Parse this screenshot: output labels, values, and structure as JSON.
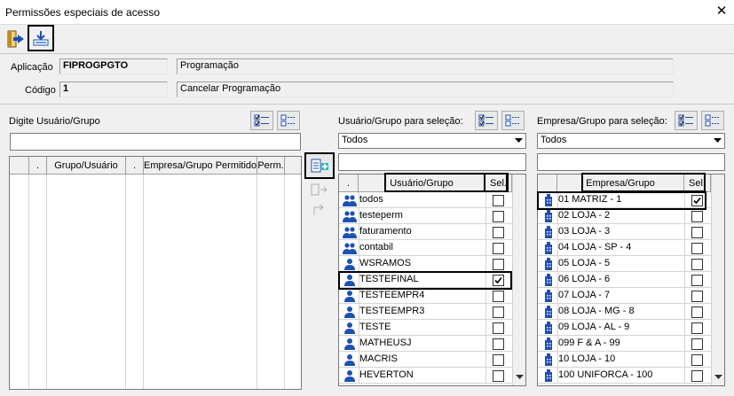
{
  "window": {
    "title": "Permissões especiais de acesso",
    "close": "✕"
  },
  "toolbar": {
    "exit": "exit-icon",
    "save": "save-icon"
  },
  "app": {
    "aplicacao_label": "Aplicação",
    "aplicacao_code": "FIPROGPGTO",
    "aplicacao_desc": "Programação",
    "codigo_label": "Código",
    "codigo_value": "1",
    "codigo_desc": "Cancelar Programação"
  },
  "left": {
    "label": "Digite Usuário/Grupo",
    "columns": [
      ".",
      "Grupo/Usuário",
      ".",
      "Empresa/Grupo Permitido",
      "Perm."
    ]
  },
  "users": {
    "label": "Usuário/Grupo para seleção:",
    "filter": "Todos",
    "col_name": "Usuário/Grupo",
    "col_sel": "Sel.",
    "dot": ".",
    "rows": [
      {
        "name": "todos",
        "type": "group",
        "sel": false
      },
      {
        "name": "testeperm",
        "type": "group",
        "sel": false
      },
      {
        "name": "faturamento",
        "type": "group",
        "sel": false
      },
      {
        "name": "contabil",
        "type": "group",
        "sel": false
      },
      {
        "name": "WSRAMOS",
        "type": "user",
        "sel": false
      },
      {
        "name": "TESTEFINAL",
        "type": "user",
        "sel": true
      },
      {
        "name": "TESTEEMPR4",
        "type": "user",
        "sel": false
      },
      {
        "name": "TESTEEMPR3",
        "type": "user",
        "sel": false
      },
      {
        "name": "TESTE",
        "type": "user",
        "sel": false
      },
      {
        "name": "MATHEUSJ",
        "type": "user",
        "sel": false
      },
      {
        "name": "MACRIS",
        "type": "user",
        "sel": false
      },
      {
        "name": "HEVERTON",
        "type": "user",
        "sel": false
      }
    ]
  },
  "companies": {
    "label": "Empresa/Grupo para seleção:",
    "filter": "Todos",
    "col_name": "Empresa/Grupo",
    "col_sel": "Sel.",
    "rows": [
      {
        "name": "01 MATRIZ - 1",
        "sel": true
      },
      {
        "name": "02 LOJA - 2",
        "sel": false
      },
      {
        "name": "03 LOJA - 3",
        "sel": false
      },
      {
        "name": "04 LOJA - SP - 4",
        "sel": false
      },
      {
        "name": "05 LOJA - 5",
        "sel": false
      },
      {
        "name": "06 LOJA - 6",
        "sel": false
      },
      {
        "name": "07 LOJA - 7",
        "sel": false
      },
      {
        "name": "08 LOJA - MG - 8",
        "sel": false
      },
      {
        "name": "09 LOJA - AL - 9",
        "sel": false
      },
      {
        "name": "099 F & A - 99",
        "sel": false
      },
      {
        "name": "10 LOJA - 10",
        "sel": false
      },
      {
        "name": "100 UNIFORCA - 100",
        "sel": false
      }
    ]
  },
  "colors": {
    "icon_blue": "#1e50b4",
    "border_dark": "#000000"
  }
}
